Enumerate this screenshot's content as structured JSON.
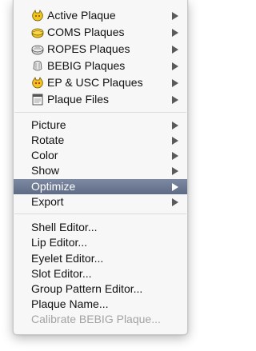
{
  "menu": {
    "group1": [
      {
        "label": "Active Plaque",
        "icon": "yellow-plaque-icon"
      },
      {
        "label": "COMS Plaques",
        "icon": "coms-plaque-icon"
      },
      {
        "label": "ROPES Plaques",
        "icon": "ropes-plaque-icon"
      },
      {
        "label": "BEBIG Plaques",
        "icon": "bebig-plaque-icon"
      },
      {
        "label": "EP & USC Plaques",
        "icon": "ep-usc-plaque-icon"
      },
      {
        "label": "Plaque Files",
        "icon": "file-icon"
      }
    ],
    "group2": [
      {
        "label": "Picture"
      },
      {
        "label": "Rotate"
      },
      {
        "label": "Color"
      },
      {
        "label": "Show"
      },
      {
        "label": "Optimize"
      },
      {
        "label": "Export"
      }
    ],
    "group3": [
      {
        "label": "Shell Editor..."
      },
      {
        "label": "Lip Editor..."
      },
      {
        "label": "Eyelet Editor..."
      },
      {
        "label": "Slot Editor..."
      },
      {
        "label": "Group Pattern Editor..."
      },
      {
        "label": "Plaque Name..."
      },
      {
        "label": "Calibrate BEBIG Plaque..."
      }
    ],
    "highlight_color": "#6b7894",
    "disabled_color": "#a3a3a3"
  }
}
